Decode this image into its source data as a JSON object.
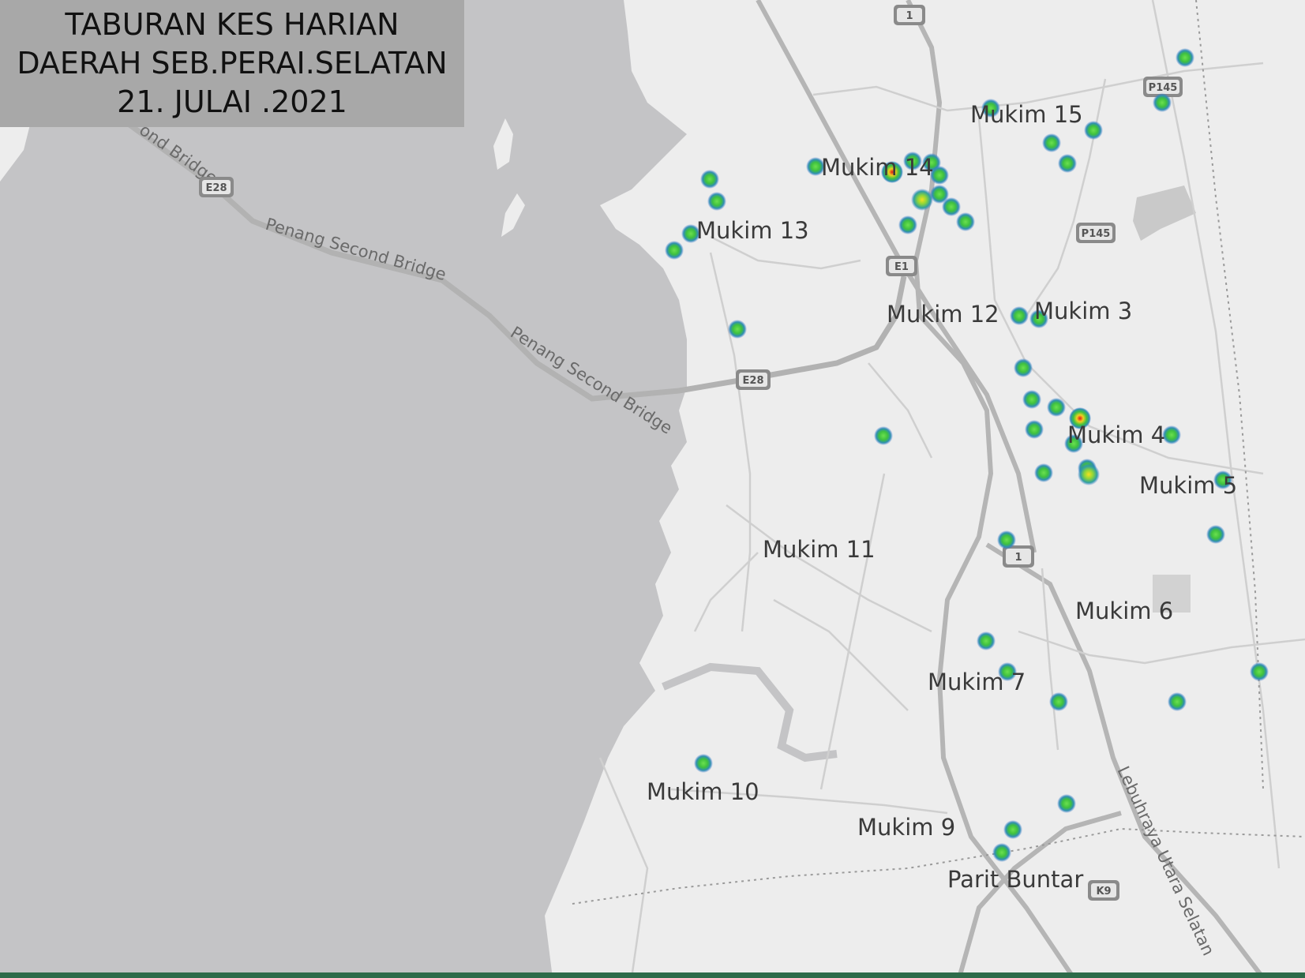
{
  "title": {
    "line1": "TABURAN KES HARIAN",
    "line2": "DAERAH SEB.PERAI.SELATAN",
    "line3": "21. JULAI .2021"
  },
  "colors": {
    "sea": "#c4c4c6",
    "land": "#eeeeee",
    "road": "#b8b8b8",
    "marker_green": "#4cc94c",
    "marker_blue": "#2f6fd0",
    "marker_hot": "#e02020",
    "title_bg": "#a8a8a8",
    "footer_bar": "#2e6b4a"
  },
  "map": {
    "place_labels": [
      "Mukim 15",
      "Mukim 14",
      "Mukim 13",
      "Mukim 12",
      "Mukim 3",
      "Mukim 4",
      "Mukim 5",
      "Mukim 11",
      "Mukim 6",
      "Mukim 7",
      "Mukim 10",
      "Mukim 9",
      "Parit Buntar"
    ],
    "road_labels": {
      "bridge1": "Penang Second Bridge",
      "bridge2": "Penang Second Bridge",
      "bridge_frag": "ond Bridge",
      "highway": "Lebuhraya Utara Selatan"
    },
    "shields": [
      "1",
      "P145",
      "E28",
      "P145",
      "E1",
      "E28",
      "1",
      "K9"
    ]
  }
}
